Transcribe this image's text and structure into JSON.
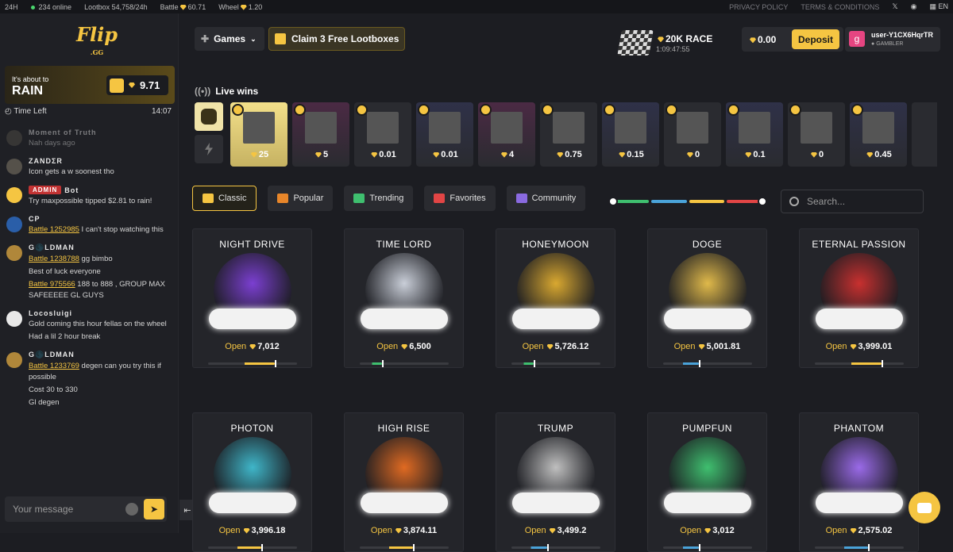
{
  "topbar": {
    "region": "24H",
    "online": "234 online",
    "stats": [
      {
        "label": "Lootbox",
        "value": "54,758/24h"
      },
      {
        "label": "Battle",
        "value": "60.71"
      },
      {
        "label": "Wheel",
        "value": "1.20"
      }
    ],
    "privacy": "PRIVACY POLICY",
    "terms": "TERMS & CONDITIONS",
    "language": "EN"
  },
  "logo": {
    "main": "Flip",
    "sub": ".GG"
  },
  "rain": {
    "line1": "It's about to",
    "line2": "RAIN",
    "amount": "9.71",
    "time_label": "Time Left",
    "time_value": "14:07"
  },
  "chat": {
    "messages": [
      {
        "name": "Moment of Truth",
        "text": "Nah days ago"
      },
      {
        "name": "ZANDΣR",
        "text": "Icon gets a w soonest tho"
      },
      {
        "badge": "ADMIN",
        "name": "Bot",
        "text": "Try maxpossible tipped $2.81 to rain!"
      },
      {
        "name": "CP",
        "link": "Battle 1252985",
        "text": " I can't stop watching this"
      },
      {
        "name": "G🌑LDMAN",
        "link": "Battle 1238788",
        "text": " gg bimbo",
        "text2": "Best of luck everyone",
        "link3": "Battle 975566",
        "text3": " 188 to 888 , GROUP MAX SAFEEEEE GL GUYS"
      },
      {
        "name": "Locosluigi",
        "text": "Gold coming this hour fellas on the wheel",
        "text2": "Had a lil 2 hour break"
      },
      {
        "name": "G🌑LDMAN",
        "link": "Battle 1233769",
        "text": " degen can you try this if possible",
        "text2": "Cost 30 to 330",
        "text3": "Gl degen"
      }
    ],
    "input_placeholder": "Your message"
  },
  "header": {
    "games": "Games",
    "claim": "Claim 3 Free Lootboxes",
    "race_title": "20K RACE",
    "race_timer": "1:09:47:55",
    "balance": "0.00",
    "deposit": "Deposit",
    "user_initial": "g",
    "user_name": "user-Y1CX6HqrTR",
    "user_rank": "GAMBLER"
  },
  "live_wins": {
    "label": "Live wins",
    "items": [
      "25",
      "5",
      "0.01",
      "0.01",
      "4",
      "0.75",
      "0.15",
      "0",
      "0.1",
      "0",
      "0.45"
    ]
  },
  "filters": [
    {
      "label": "Classic",
      "color": "#f5c542"
    },
    {
      "label": "Popular",
      "color": "#e8862a"
    },
    {
      "label": "Trending",
      "color": "#3fbf6f"
    },
    {
      "label": "Favorites",
      "color": "#e24545"
    },
    {
      "label": "Community",
      "color": "#8a6ae0"
    }
  ],
  "slider_colors": [
    "#3fbf6f",
    "#4aa3d9",
    "#f5c542",
    "#e24545"
  ],
  "search_placeholder": "Search...",
  "open_label": "Open",
  "cards": [
    {
      "name": "NIGHT DRIVE",
      "price": "7,012",
      "color": "#7b3fd1",
      "bar": "#f5c542",
      "level": 0.75
    },
    {
      "name": "TIME LORD",
      "price": "6,500",
      "color": "#c9ced8",
      "bar": "#3fbf6f",
      "level": 0.25
    },
    {
      "name": "HONEYMOON",
      "price": "5,726.12",
      "color": "#d9a830",
      "bar": "#3fbf6f",
      "level": 0.25
    },
    {
      "name": "DOGE",
      "price": "5,001.81",
      "color": "#e0b94a",
      "bar": "#4aa3d9",
      "level": 0.4
    },
    {
      "name": "ETERNAL PASSION",
      "price": "3,999.01",
      "color": "#c8302f",
      "bar": "#f5c542",
      "level": 0.75
    },
    {
      "name": "PHOTON",
      "price": "3,996.18",
      "color": "#3fb6c9",
      "bar": "#f5c542",
      "level": 0.6
    },
    {
      "name": "HIGH RISE",
      "price": "3,874.11",
      "color": "#e06a22",
      "bar": "#f5c542",
      "level": 0.6
    },
    {
      "name": "TRUMP",
      "price": "3,499.2",
      "color": "#bfbfbf",
      "bar": "#4aa3d9",
      "level": 0.4
    },
    {
      "name": "PUMPFUN",
      "price": "3,012",
      "color": "#3fbf6f",
      "bar": "#4aa3d9",
      "level": 0.4
    },
    {
      "name": "PHANTOM",
      "price": "2,575.02",
      "color": "#9a6ae8",
      "bar": "#4aa3d9",
      "level": 0.6
    }
  ]
}
